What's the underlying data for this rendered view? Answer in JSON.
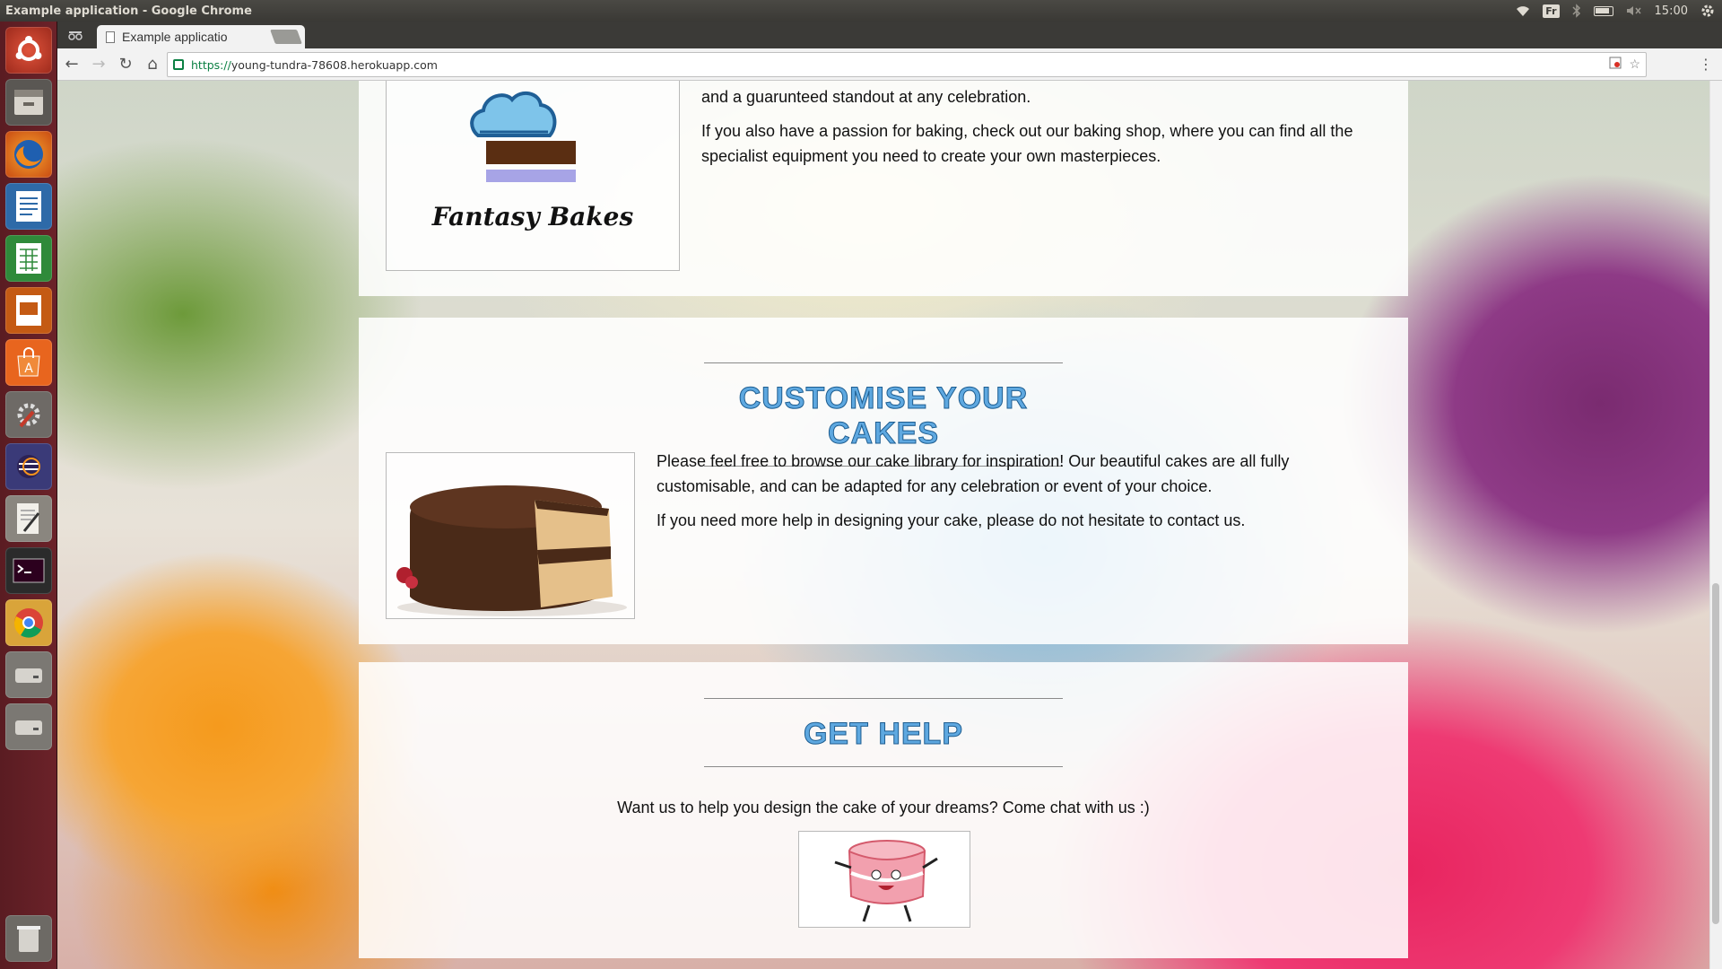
{
  "os": {
    "window_title": "Example application - Google Chrome",
    "keyboard_layout": "Fr",
    "clock": "15:00",
    "launcher_icons": [
      "ubuntu-logo-icon",
      "files-icon",
      "firefox-icon",
      "writer-icon",
      "calc-icon",
      "impress-icon",
      "software-center-icon",
      "system-settings-icon",
      "eclipse-icon",
      "text-editor-icon",
      "terminal-icon",
      "chrome-icon",
      "drive-icon",
      "drive-icon",
      "trash-icon"
    ]
  },
  "browser": {
    "tab_title": "Example applicatio",
    "tab_close": "×",
    "url_scheme": "https://",
    "url_host": "young-tundra-78608.herokuapp.com",
    "back": "←",
    "forward": "→",
    "reload": "↻",
    "home": "⌂",
    "bookmark_star": "☆",
    "menu": "⋮"
  },
  "about": {
    "logo_text": "Fantasy Bakes",
    "p1": "and a guarunteed standout at any celebration.",
    "p2": "If you also have a passion for baking, check out our baking shop, where you can find all the specialist equipment you need to create your own masterpieces."
  },
  "customise": {
    "title": "CUSTOMISE YOUR CAKES",
    "p1": "Please feel free to browse our cake library for inspiration! Our beautiful cakes are all fully customisable, and can be adapted for any celebration or event of your choice.",
    "p2": "If you need more help in designing your cake, please do not hesitate to contact us."
  },
  "help": {
    "title": "GET HELP",
    "text": "Want us to help you design the cake of your dreams? Come chat with us :)"
  },
  "colors": {
    "heading_fill": "#5ea8e0",
    "heading_stroke": "#1d5d90",
    "launcher_bg": "#6b2229",
    "secure_green": "#0b8043"
  }
}
